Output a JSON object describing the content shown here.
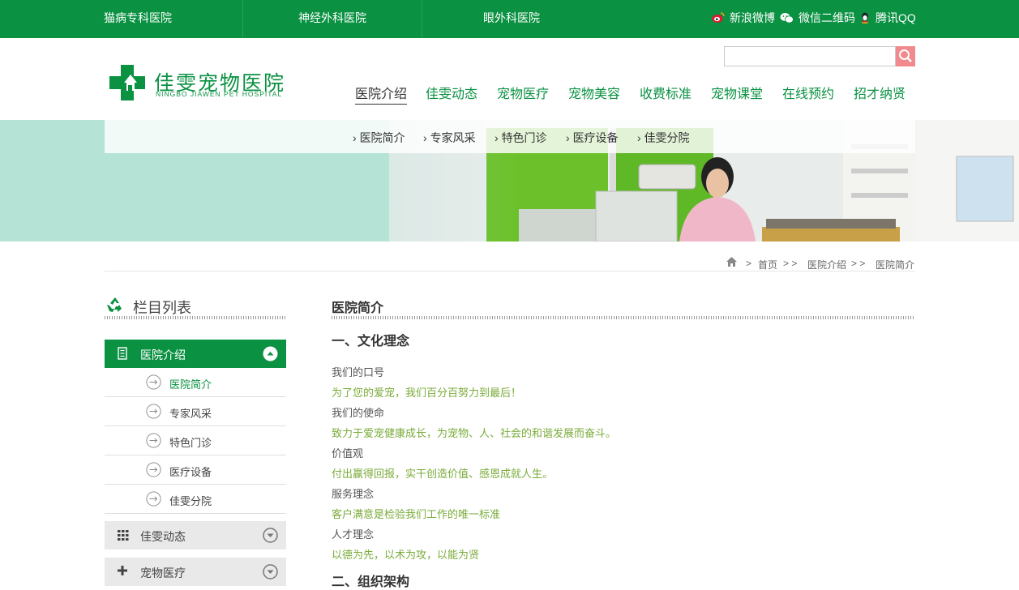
{
  "topbar": {
    "links": [
      "猫病专科医院",
      "神经外科医院",
      "眼外科医院"
    ],
    "social": {
      "weibo": "新浪微博",
      "wechat": "微信二维码",
      "qq": "腾讯QQ"
    }
  },
  "logo": {
    "title": "佳雯宠物医院",
    "subtitle": "NINGBO JIAWEN PET HOSPITAL"
  },
  "search": {
    "placeholder": ""
  },
  "nav": [
    "医院介绍",
    "佳雯动态",
    "宠物医疗",
    "宠物美容",
    "收费标准",
    "宠物课堂",
    "在线预约",
    "招才纳贤"
  ],
  "subnav": [
    "医院简介",
    "专家风采",
    "特色门诊",
    "医疗设备",
    "佳雯分院"
  ],
  "breadcrumb": {
    "home": "首页",
    "sep": "> >",
    "level1": "医院介绍",
    "level2": "医院简介"
  },
  "sidebar": {
    "title": "栏目列表",
    "active_section": "医院介绍",
    "sub_items": [
      "医院简介",
      "专家风采",
      "特色门诊",
      "医疗设备",
      "佳雯分院"
    ],
    "other_sections": [
      "佳雯动态",
      "宠物医疗"
    ]
  },
  "content": {
    "page_title": "医院简介",
    "heading1": "一、文化理念",
    "items": [
      {
        "label": "我们的口号",
        "text": "为了您的爱宠，我们百分百努力到最后！"
      },
      {
        "label": "我们的使命",
        "text": "致力于爱宠健康成长，为宠物、人、社会的和谐发展而奋斗。"
      },
      {
        "label": "价值观",
        "text": "付出赢得回报，实干创造价值、感恩成就人生。"
      },
      {
        "label": "服务理念",
        "text": "客户满意是检验我们工作的唯一标准"
      },
      {
        "label": "人才理念",
        "text": "以德为先，以术为攻，以能为贤"
      }
    ],
    "heading2": "二、组织架构"
  },
  "colors": {
    "brand_green": "#0a9142",
    "text_green": "#7aab3a",
    "banner_mint": "#b5e3d6",
    "search_button": "#f08a8f"
  }
}
